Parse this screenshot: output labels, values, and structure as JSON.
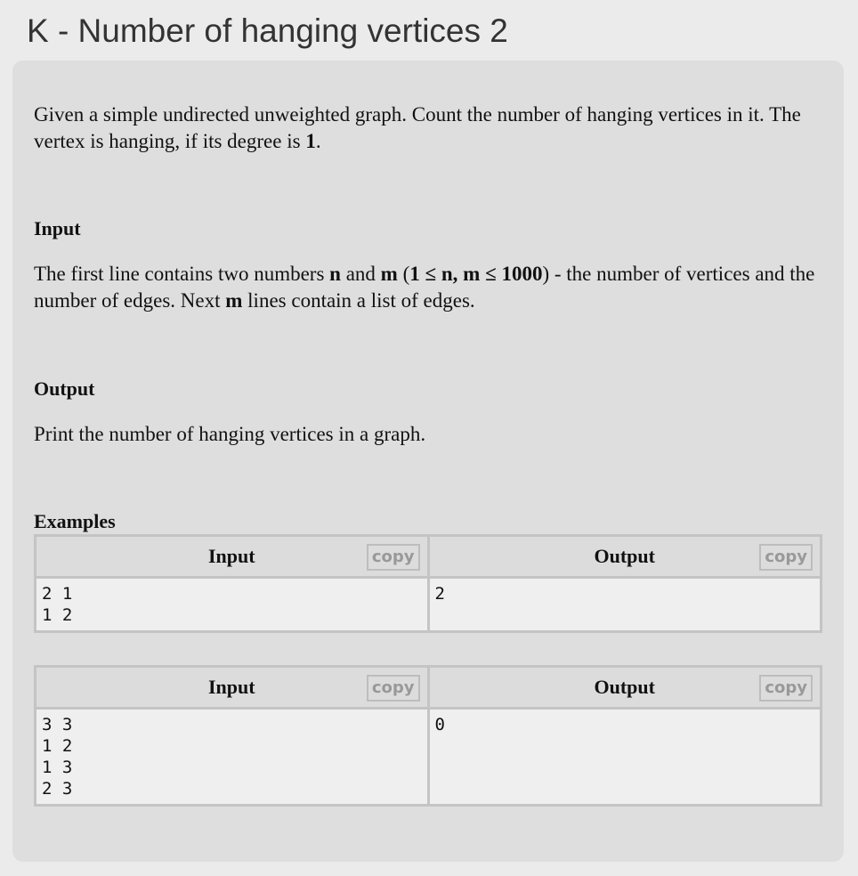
{
  "title": "K - Number of hanging vertices 2",
  "statement": {
    "p1": [
      "Given a simple undirected unweighted graph. Count the number of hanging vertices in it. The vertex is hanging, if its degree is ",
      "1",
      "."
    ],
    "input_heading": "Input",
    "p2": [
      "The first line contains two numbers ",
      "n",
      " and ",
      "m",
      " (",
      "1 ≤ n, m ≤ 1000",
      ") - the number of vertices and the number of edges. Next ",
      "m",
      " lines contain a list of edges."
    ],
    "output_heading": "Output",
    "p3": "Print the number of hanging vertices in a graph.",
    "examples_heading": "Examples"
  },
  "examples": [
    {
      "input_label": "Input",
      "output_label": "Output",
      "copy": "copy",
      "input": "2 1\n1 2",
      "output": "2"
    },
    {
      "input_label": "Input",
      "output_label": "Output",
      "copy": "copy",
      "input": "3 3\n1 2\n1 3\n2 3",
      "output": "0"
    }
  ]
}
